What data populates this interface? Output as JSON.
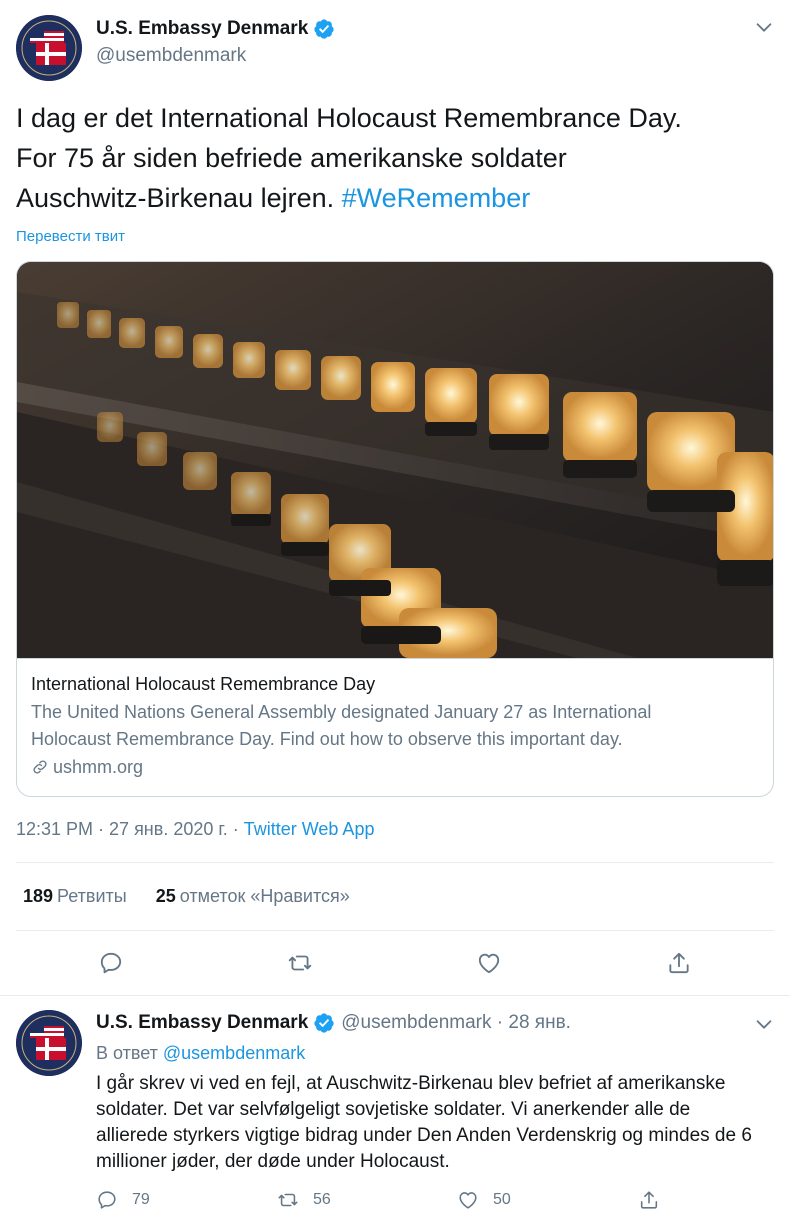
{
  "tweet": {
    "author_name": "U.S. Embassy Denmark",
    "handle": "@usembdenmark",
    "text_lines": [
      "I dag er det International Holocaust Remembrance Day.",
      "For 75 år siden befriede amerikanske soldater",
      "Auschwitz-Birkenau lejren. "
    ],
    "hashtag": "#WeRemember",
    "translate_label": "Перевести твит",
    "card": {
      "title": "International Holocaust Remembrance Day",
      "description_lines": [
        "The United Nations General Assembly designated January 27 as International",
        "Holocaust Remembrance Day. Find out how to observe this important day."
      ],
      "domain": "ushmm.org"
    },
    "time": "12:31 PM · 27 янв. 2020 г. · ",
    "source": "Twitter Web App",
    "retweets_count": "189",
    "retweets_label": "Ретвиты",
    "likes_count": "25",
    "likes_label": "отметок «Нравится»"
  },
  "reply": {
    "author_name": "U.S. Embassy Denmark",
    "handle_date": "@usembdenmark · 28 янв.",
    "reply_prefix": "В ответ ",
    "reply_to": "@usembdenmark",
    "text": "I går skrev vi ved en fejl, at Auschwitz-Birkenau blev befriet af amerikanske soldater. Det var selvfølgeligt sovjetiske soldater. Vi anerkender alle de allierede styrkers vigtige bidrag under Den Anden Verdenskrig og mindes de 6 millioner jøder, der døde under Holocaust.",
    "replies": "79",
    "retweets": "56",
    "likes": "50"
  },
  "colors": {
    "link": "#1b95e0",
    "secondary": "#657786",
    "verified": "#1da1f2"
  }
}
